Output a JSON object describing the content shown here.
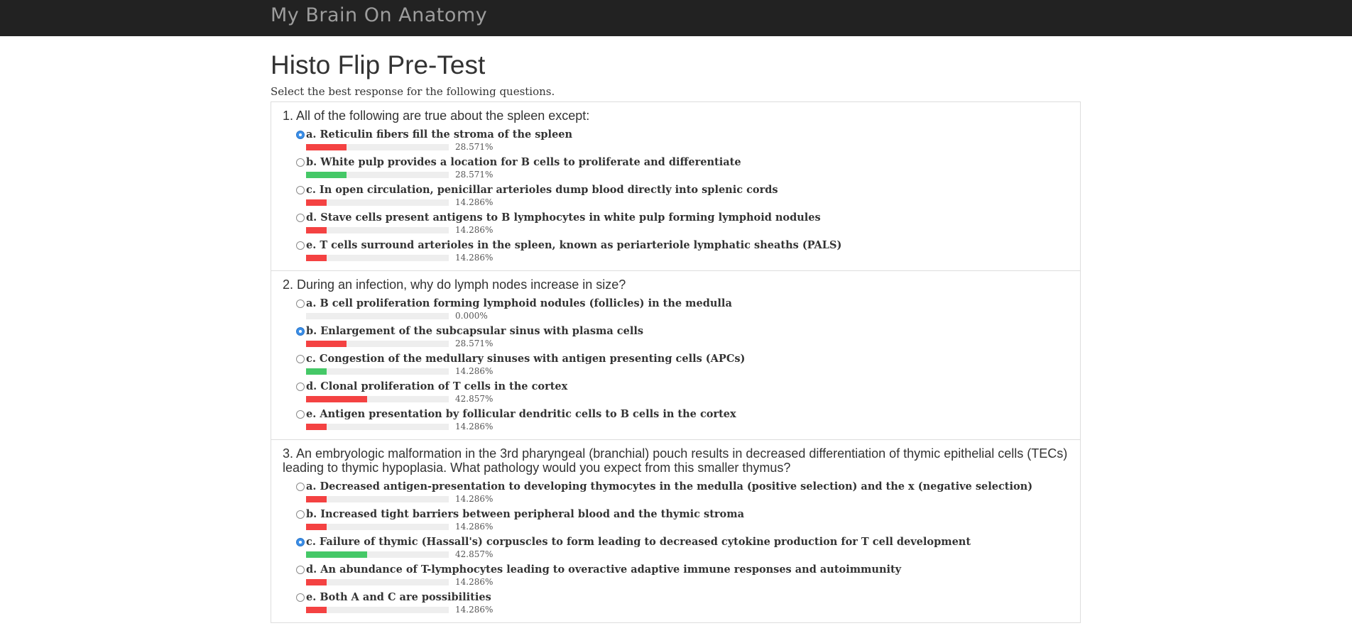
{
  "brand": "My Brain On Anatomy",
  "page": {
    "title": "Histo Flip Pre-Test",
    "subtitle": "Select the best response for the following questions."
  },
  "colors": {
    "wrong": "#f44242",
    "correct": "#45c867",
    "selected": "#3b8fe8"
  },
  "questions": [
    {
      "text": "1. All of the following are true about the spleen except:",
      "options": [
        {
          "label": "a. Reticulin fibers fill the stroma of the spleen",
          "pct": "28.571%",
          "value": 28.571,
          "selected": true,
          "correct": false
        },
        {
          "label": "b. White pulp provides a location for B cells to proliferate and differentiate",
          "pct": "28.571%",
          "value": 28.571,
          "selected": false,
          "correct": true
        },
        {
          "label": "c. In open circulation, penicillar arterioles dump blood directly into splenic cords",
          "pct": "14.286%",
          "value": 14.286,
          "selected": false,
          "correct": false
        },
        {
          "label": "d. Stave cells present antigens to B lymphocytes in white pulp forming lymphoid nodules",
          "pct": "14.286%",
          "value": 14.286,
          "selected": false,
          "correct": false
        },
        {
          "label": "e. T cells surround arterioles in the spleen, known as periarteriole lymphatic sheaths (PALS)",
          "pct": "14.286%",
          "value": 14.286,
          "selected": false,
          "correct": false
        }
      ]
    },
    {
      "text": "2. During an infection, why do lymph nodes increase in size?",
      "options": [
        {
          "label": "a. B cell proliferation forming lymphoid nodules (follicles) in the medulla",
          "pct": "0.000%",
          "value": 0,
          "selected": false,
          "correct": false
        },
        {
          "label": "b. Enlargement of the subcapsular sinus with plasma cells",
          "pct": "28.571%",
          "value": 28.571,
          "selected": true,
          "correct": false
        },
        {
          "label": "c. Congestion of the medullary sinuses with antigen presenting cells (APCs)",
          "pct": "14.286%",
          "value": 14.286,
          "selected": false,
          "correct": true
        },
        {
          "label": "d. Clonal proliferation of T cells in the cortex",
          "pct": "42.857%",
          "value": 42.857,
          "selected": false,
          "correct": false
        },
        {
          "label": "e. Antigen presentation by follicular dendritic cells to B cells in the cortex",
          "pct": "14.286%",
          "value": 14.286,
          "selected": false,
          "correct": false
        }
      ]
    },
    {
      "text": "3. An embryologic malformation in the 3rd pharyngeal (branchial) pouch results in decreased differentiation of thymic epithelial cells (TECs) leading to thymic hypoplasia. What pathology would you expect from this smaller thymus?",
      "options": [
        {
          "label": "a. Decreased antigen-presentation to developing thymocytes in the medulla (positive selection) and the x (negative selection)",
          "pct": "14.286%",
          "value": 14.286,
          "selected": false,
          "correct": false
        },
        {
          "label": "b. Increased tight barriers between peripheral blood and the thymic stroma",
          "pct": "14.286%",
          "value": 14.286,
          "selected": false,
          "correct": false
        },
        {
          "label": "c. Failure of thymic (Hassall's) corpuscles to form leading to decreased cytokine production for T cell development",
          "pct": "42.857%",
          "value": 42.857,
          "selected": true,
          "correct": true
        },
        {
          "label": "d. An abundance of T-lymphocytes leading to overactive adaptive immune responses and autoimmunity",
          "pct": "14.286%",
          "value": 14.286,
          "selected": false,
          "correct": false
        },
        {
          "label": "e. Both A and C are possibilities",
          "pct": "14.286%",
          "value": 14.286,
          "selected": false,
          "correct": false
        }
      ]
    }
  ]
}
